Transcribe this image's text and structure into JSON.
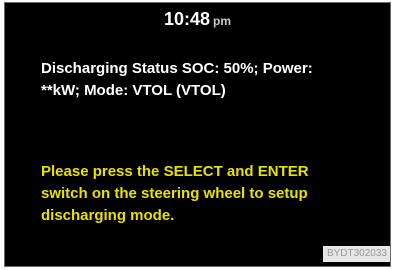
{
  "clock": {
    "time": "10:48",
    "ampm": "pm"
  },
  "status": {
    "line1": "Discharging Status SOC: 50%; Power:",
    "line2": "**kW; Mode: VTOL (VTOL)"
  },
  "instruction": {
    "line1": "Please press the SELECT and ENTER",
    "line2": "switch on the steering wheel to setup",
    "line3": "discharging mode."
  },
  "figure_code": "BYDT302033",
  "colors": {
    "screen_background": "#000000",
    "status_text": "#ffffff",
    "instruction_text": "#e8e000"
  }
}
